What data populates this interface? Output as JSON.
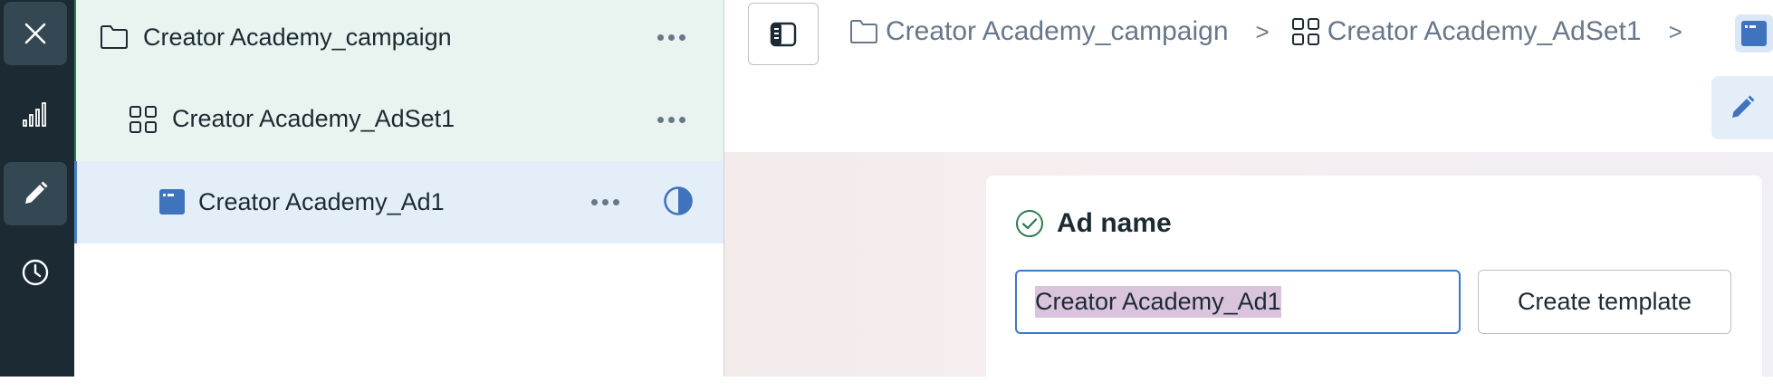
{
  "colors": {
    "rail_bg": "#1c2b33",
    "accent_blue": "#4e7fc5",
    "campaign_row_bg": "#e9f3ef",
    "ad_row_bg": "#e4eef8",
    "success_green": "#2c7a4b",
    "selection_highlight": "#dac3dc"
  },
  "rail": {
    "items": [
      {
        "icon": "close-icon"
      },
      {
        "icon": "bar-chart-icon"
      },
      {
        "icon": "pencil-icon",
        "active": true
      },
      {
        "icon": "clock-icon"
      }
    ]
  },
  "tree": {
    "campaign": {
      "label": "Creator Academy_campaign",
      "icon": "folder-icon"
    },
    "adset": {
      "label": "Creator Academy_AdSet1",
      "icon": "grid-icon"
    },
    "ad": {
      "label": "Creator Academy_Ad1",
      "icon": "ad-icon",
      "status_icon": "half-circle-icon"
    }
  },
  "breadcrumb": {
    "items": [
      {
        "label": "Creator Academy_campaign",
        "icon": "folder-icon"
      },
      {
        "label": "Creator Academy_AdSet1",
        "icon": "grid-icon"
      }
    ],
    "separator": ">",
    "trailing_icon": "ad-icon"
  },
  "ad_name_section": {
    "title": "Ad name",
    "input_value": "Creator Academy_Ad1",
    "template_button": "Create template"
  }
}
